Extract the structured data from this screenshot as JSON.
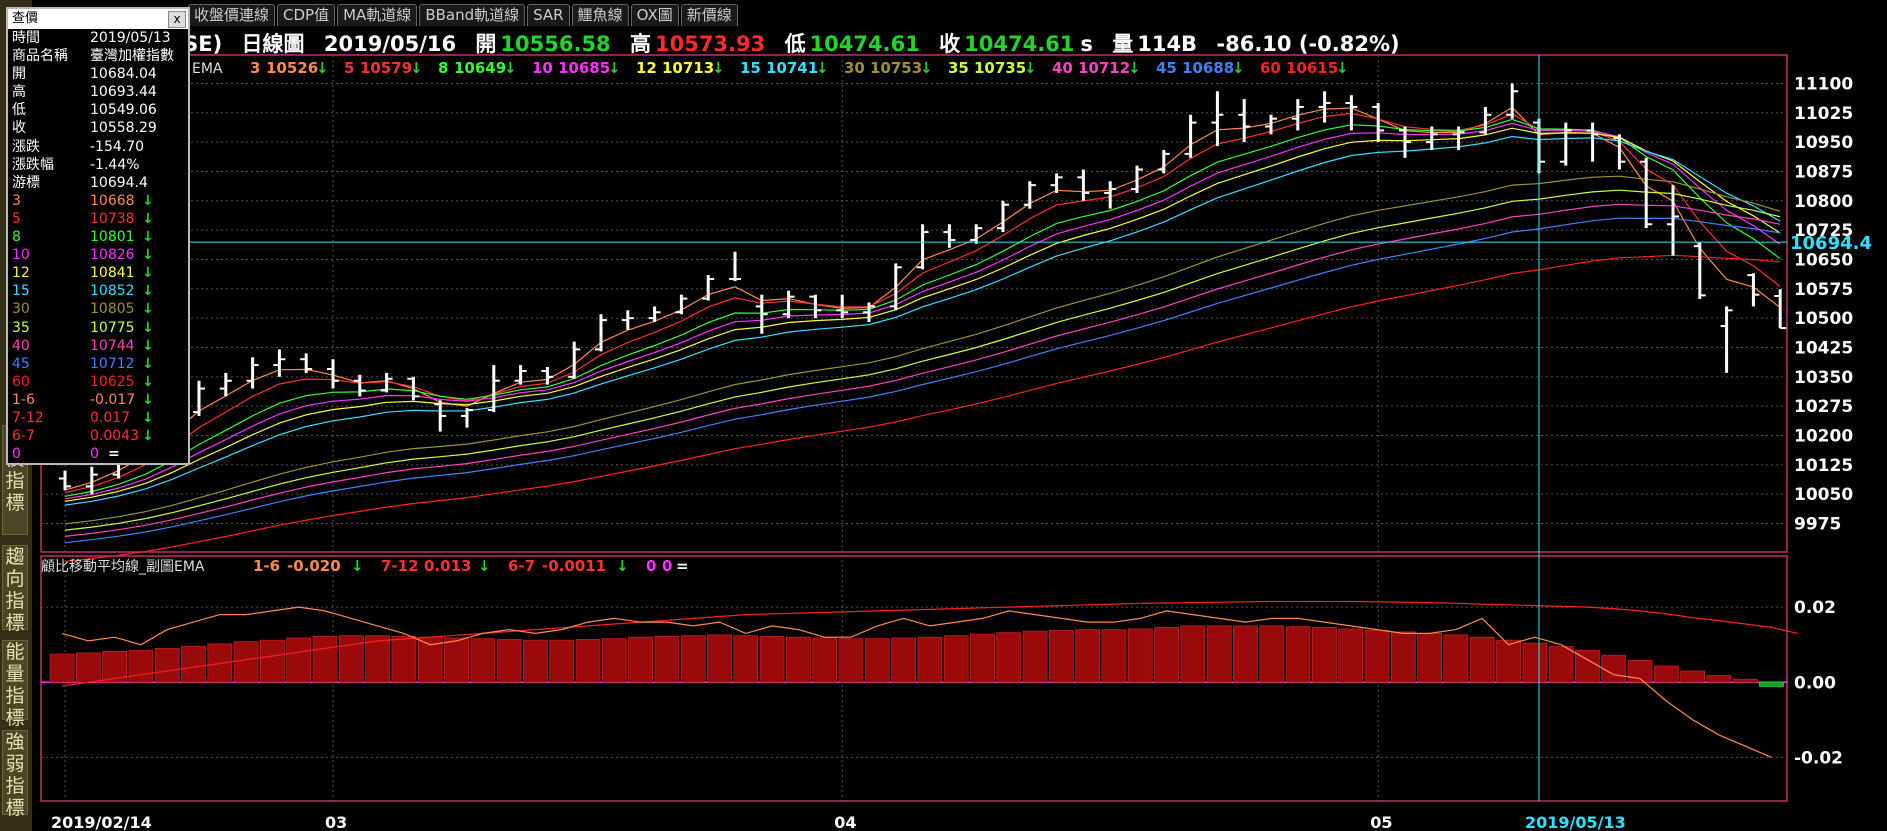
{
  "tabs": [
    "收盤價連線",
    "CDP值",
    "MA軌道線",
    "BBand軌道線",
    "SAR",
    "鱷魚線",
    "OX圖",
    "新價線"
  ],
  "header": {
    "symbol": "WSE)",
    "chart_type": "日線圖",
    "date": "2019/05/16",
    "open_label": "開",
    "open": "10556.58",
    "high_label": "高",
    "high": "10573.93",
    "low_label": "低",
    "low": "10474.61",
    "close_label": "收",
    "close": "10474.61",
    "close_suffix": "s",
    "volume_label": "量",
    "volume": "114B",
    "change": "-86.10 (-0.82%)"
  },
  "ema_legend": {
    "prefix": "EMA",
    "items": [
      {
        "label": "3",
        "value": "10526",
        "color": "#ff8a4a"
      },
      {
        "label": "5",
        "value": "10579",
        "color": "#ff3030"
      },
      {
        "label": "8",
        "value": "10649",
        "color": "#30ff30"
      },
      {
        "label": "10",
        "value": "10685",
        "color": "#ff30ff"
      },
      {
        "label": "12",
        "value": "10713",
        "color": "#ffff30"
      },
      {
        "label": "15",
        "value": "10741",
        "color": "#30e0ff"
      },
      {
        "label": "30",
        "value": "10753",
        "color": "#a09030"
      },
      {
        "label": "35",
        "value": "10735",
        "color": "#d0ff30"
      },
      {
        "label": "40",
        "value": "10712",
        "color": "#ff40c0"
      },
      {
        "label": "45",
        "value": "10688",
        "color": "#4080ff"
      },
      {
        "label": "60",
        "value": "10615",
        "color": "#ff2020"
      }
    ]
  },
  "sub_legend": {
    "title": "顧比移動平均線_副圖EMA",
    "items": [
      {
        "label": "1-6",
        "value": "-0.020",
        "color": "#ff8a4a",
        "arrow": "↓"
      },
      {
        "label": "7-12",
        "value": "0.013",
        "color": "#ff3030",
        "arrow": "↓"
      },
      {
        "label": "6-7",
        "value": "-0.0011",
        "color": "#ff3030",
        "arrow": "↓"
      },
      {
        "label": "0",
        "value": "0",
        "color": "#ff30ff",
        "arrow": "="
      }
    ]
  },
  "crosshair_label": "10694.4",
  "sidebar": [
    "能價指標",
    "趨向指標",
    "能量指標",
    "強弱指標"
  ],
  "query": {
    "title": "查價",
    "close_icon": "x",
    "rows": [
      {
        "label": "時間",
        "value": "2019/05/13",
        "color": "#ffffff",
        "arrow": ""
      },
      {
        "label": "商品名稱",
        "value": "臺灣加權指數",
        "color": "#ffffff",
        "arrow": ""
      },
      {
        "label": "開",
        "value": "10684.04",
        "color": "#ffffff",
        "arrow": ""
      },
      {
        "label": "高",
        "value": "10693.44",
        "color": "#ffffff",
        "arrow": ""
      },
      {
        "label": "低",
        "value": "10549.06",
        "color": "#ffffff",
        "arrow": ""
      },
      {
        "label": "收",
        "value": "10558.29",
        "color": "#ffffff",
        "arrow": ""
      },
      {
        "label": "漲跌",
        "value": "-154.70",
        "color": "#ffffff",
        "arrow": ""
      },
      {
        "label": "漲跌幅",
        "value": "-1.44%",
        "color": "#ffffff",
        "arrow": ""
      },
      {
        "label": "游標",
        "value": "10694.4",
        "color": "#ffffff",
        "arrow": ""
      },
      {
        "label": "3",
        "value": "10668",
        "color": "#ff8a4a",
        "arrow": "↓"
      },
      {
        "label": "5",
        "value": "10738",
        "color": "#ff3030",
        "arrow": "↓"
      },
      {
        "label": "8",
        "value": "10801",
        "color": "#30ff30",
        "arrow": "↓"
      },
      {
        "label": "10",
        "value": "10826",
        "color": "#ff30ff",
        "arrow": "↓"
      },
      {
        "label": "12",
        "value": "10841",
        "color": "#ffff30",
        "arrow": "↓"
      },
      {
        "label": "15",
        "value": "10852",
        "color": "#30e0ff",
        "arrow": "↓"
      },
      {
        "label": "30",
        "value": "10805",
        "color": "#a09030",
        "arrow": "↓"
      },
      {
        "label": "35",
        "value": "10775",
        "color": "#d0ff30",
        "arrow": "↓"
      },
      {
        "label": "40",
        "value": "10744",
        "color": "#ff40c0",
        "arrow": "↓"
      },
      {
        "label": "45",
        "value": "10712",
        "color": "#4080ff",
        "arrow": "↓"
      },
      {
        "label": "60",
        "value": "10625",
        "color": "#ff2020",
        "arrow": "↓"
      },
      {
        "label": "1-6",
        "value": "-0.017",
        "color": "#ff8a4a",
        "arrow": "↓"
      },
      {
        "label": "7-12",
        "value": "0.017",
        "color": "#ff3030",
        "arrow": "↓"
      },
      {
        "label": "6-7",
        "value": "0.0043",
        "color": "#ff3030",
        "arrow": "↓"
      },
      {
        "label": "0",
        "value": "0",
        "color": "#ff30ff",
        "arrow": "="
      }
    ]
  },
  "chart_data": [
    {
      "type": "ohlc",
      "ylim": [
        9920,
        11160
      ],
      "yticks": [
        11100,
        11025,
        10950,
        10875,
        10800,
        10725,
        10650,
        10575,
        10500,
        10425,
        10350,
        10275,
        10200,
        10125,
        10050,
        9975
      ],
      "xticks": [
        {
          "label": "2019/02/14",
          "index": 0,
          "highlight": false
        },
        {
          "label": "03",
          "index": 10,
          "highlight": false
        },
        {
          "label": "04",
          "index": 29,
          "highlight": false
        },
        {
          "label": "05",
          "index": 49,
          "highlight": false
        },
        {
          "label": "2019/05/13",
          "index": 55,
          "highlight": true
        }
      ],
      "crosshair": {
        "index": 55,
        "value": 10694.4
      },
      "bars": [
        {
          "o": 10090,
          "h": 10110,
          "l": 10060,
          "c": 10070
        },
        {
          "o": 10070,
          "h": 10120,
          "l": 10050,
          "c": 10100
        },
        {
          "o": 10100,
          "h": 10160,
          "l": 10090,
          "c": 10140
        },
        {
          "o": 10140,
          "h": 10200,
          "l": 10130,
          "c": 10190
        },
        {
          "o": 10190,
          "h": 10280,
          "l": 10180,
          "c": 10260
        },
        {
          "o": 10260,
          "h": 10340,
          "l": 10250,
          "c": 10320
        },
        {
          "o": 10320,
          "h": 10360,
          "l": 10300,
          "c": 10340
        },
        {
          "o": 10340,
          "h": 10400,
          "l": 10320,
          "c": 10380
        },
        {
          "o": 10380,
          "h": 10420,
          "l": 10350,
          "c": 10395
        },
        {
          "o": 10395,
          "h": 10410,
          "l": 10360,
          "c": 10370
        },
        {
          "o": 10370,
          "h": 10395,
          "l": 10320,
          "c": 10340
        },
        {
          "o": 10340,
          "h": 10355,
          "l": 10300,
          "c": 10315
        },
        {
          "o": 10315,
          "h": 10360,
          "l": 10310,
          "c": 10345
        },
        {
          "o": 10345,
          "h": 10350,
          "l": 10290,
          "c": 10300
        },
        {
          "o": 10280,
          "h": 10290,
          "l": 10210,
          "c": 10250
        },
        {
          "o": 10250,
          "h": 10270,
          "l": 10220,
          "c": 10265
        },
        {
          "o": 10265,
          "h": 10380,
          "l": 10260,
          "c": 10340
        },
        {
          "o": 10340,
          "h": 10380,
          "l": 10330,
          "c": 10365
        },
        {
          "o": 10365,
          "h": 10375,
          "l": 10330,
          "c": 10350
        },
        {
          "o": 10350,
          "h": 10440,
          "l": 10345,
          "c": 10420
        },
        {
          "o": 10420,
          "h": 10510,
          "l": 10415,
          "c": 10495
        },
        {
          "o": 10495,
          "h": 10520,
          "l": 10470,
          "c": 10500
        },
        {
          "o": 10500,
          "h": 10530,
          "l": 10490,
          "c": 10515
        },
        {
          "o": 10515,
          "h": 10560,
          "l": 10510,
          "c": 10550
        },
        {
          "o": 10550,
          "h": 10610,
          "l": 10545,
          "c": 10600
        },
        {
          "o": 10600,
          "h": 10670,
          "l": 10595,
          "c": 10600
        },
        {
          "o": 10530,
          "h": 10560,
          "l": 10460,
          "c": 10510
        },
        {
          "o": 10510,
          "h": 10570,
          "l": 10500,
          "c": 10555
        },
        {
          "o": 10555,
          "h": 10560,
          "l": 10500,
          "c": 10520
        },
        {
          "o": 10520,
          "h": 10560,
          "l": 10500,
          "c": 10515
        },
        {
          "o": 10515,
          "h": 10540,
          "l": 10490,
          "c": 10530
        },
        {
          "o": 10530,
          "h": 10640,
          "l": 10520,
          "c": 10630
        },
        {
          "o": 10630,
          "h": 10740,
          "l": 10625,
          "c": 10720
        },
        {
          "o": 10720,
          "h": 10740,
          "l": 10680,
          "c": 10700
        },
        {
          "o": 10700,
          "h": 10740,
          "l": 10690,
          "c": 10730
        },
        {
          "o": 10730,
          "h": 10800,
          "l": 10720,
          "c": 10790
        },
        {
          "o": 10790,
          "h": 10850,
          "l": 10780,
          "c": 10840
        },
        {
          "o": 10840,
          "h": 10870,
          "l": 10820,
          "c": 10860
        },
        {
          "o": 10860,
          "h": 10880,
          "l": 10800,
          "c": 10820
        },
        {
          "o": 10820,
          "h": 10850,
          "l": 10780,
          "c": 10830
        },
        {
          "o": 10830,
          "h": 10890,
          "l": 10820,
          "c": 10880
        },
        {
          "o": 10880,
          "h": 10930,
          "l": 10870,
          "c": 10920
        },
        {
          "o": 10920,
          "h": 11020,
          "l": 10910,
          "c": 11000
        },
        {
          "o": 11000,
          "h": 11080,
          "l": 10940,
          "c": 11020
        },
        {
          "o": 11020,
          "h": 11060,
          "l": 10950,
          "c": 10990
        },
        {
          "o": 10990,
          "h": 11020,
          "l": 10970,
          "c": 11010
        },
        {
          "o": 11010,
          "h": 11060,
          "l": 10980,
          "c": 11040
        },
        {
          "o": 11040,
          "h": 11080,
          "l": 11000,
          "c": 11050
        },
        {
          "o": 11050,
          "h": 11070,
          "l": 10980,
          "c": 11040
        },
        {
          "o": 11040,
          "h": 11050,
          "l": 10950,
          "c": 10980
        },
        {
          "o": 10980,
          "h": 10990,
          "l": 10910,
          "c": 10950
        },
        {
          "o": 10950,
          "h": 10990,
          "l": 10930,
          "c": 10970
        },
        {
          "o": 10970,
          "h": 10990,
          "l": 10930,
          "c": 10975
        },
        {
          "o": 10975,
          "h": 11040,
          "l": 10970,
          "c": 11020
        },
        {
          "o": 11020,
          "h": 11100,
          "l": 11010,
          "c": 11080
        },
        {
          "o": 11000,
          "h": 11010,
          "l": 10870,
          "c": 10900
        },
        {
          "o": 10900,
          "h": 11000,
          "l": 10890,
          "c": 10980
        },
        {
          "o": 10980,
          "h": 11000,
          "l": 10900,
          "c": 10970
        },
        {
          "o": 10960,
          "h": 10970,
          "l": 10880,
          "c": 10900
        },
        {
          "o": 10900,
          "h": 10910,
          "l": 10730,
          "c": 10740
        },
        {
          "o": 10740,
          "h": 10840,
          "l": 10660,
          "c": 10760
        },
        {
          "o": 10684.04,
          "h": 10693.44,
          "l": 10549.06,
          "c": 10558.29
        },
        {
          "o": 10480,
          "h": 10530,
          "l": 10360,
          "c": 10520
        },
        {
          "o": 10610,
          "h": 10615,
          "l": 10530,
          "c": 10560
        },
        {
          "o": 10556.58,
          "h": 10573.93,
          "l": 10474.61,
          "c": 10474.61
        }
      ]
    },
    {
      "type": "bar",
      "ylim": [
        -0.03,
        0.032
      ],
      "yticks": [
        0.02,
        0.0,
        -0.02
      ],
      "ytick_labels": [
        "0.02",
        "0.00",
        "-0.02"
      ],
      "series": [
        {
          "name": "6-7",
          "values": [
            0.0075,
            0.0078,
            0.0082,
            0.0085,
            0.009,
            0.0096,
            0.0102,
            0.0108,
            0.0112,
            0.0118,
            0.0122,
            0.0124,
            0.0124,
            0.0122,
            0.012,
            0.0118,
            0.0116,
            0.0114,
            0.0112,
            0.0112,
            0.0114,
            0.0116,
            0.012,
            0.0122,
            0.0124,
            0.0126,
            0.0124,
            0.0122,
            0.012,
            0.0118,
            0.0116,
            0.0116,
            0.0118,
            0.012,
            0.0124,
            0.0128,
            0.0132,
            0.0136,
            0.0138,
            0.014,
            0.014,
            0.0142,
            0.0146,
            0.015,
            0.015,
            0.015,
            0.015,
            0.0148,
            0.0146,
            0.0142,
            0.0138,
            0.0134,
            0.013,
            0.0126,
            0.012,
            0.0112,
            0.0104,
            0.0095,
            0.0085,
            0.0072,
            0.0058,
            0.0043,
            0.003,
            0.0018,
            0.0008,
            -0.0011
          ]
        },
        {
          "name": "7-12",
          "values": [
            -0.001,
            0.0,
            0.001,
            0.002,
            0.003,
            0.004,
            0.005,
            0.006,
            0.007,
            0.008,
            0.009,
            0.01,
            0.011,
            0.0115,
            0.012,
            0.0125,
            0.013,
            0.0135,
            0.014,
            0.0145,
            0.015,
            0.0155,
            0.016,
            0.0165,
            0.017,
            0.0175,
            0.018,
            0.0182,
            0.0184,
            0.0186,
            0.0188,
            0.019,
            0.0192,
            0.0194,
            0.0196,
            0.0198,
            0.02,
            0.0202,
            0.0204,
            0.0206,
            0.0208,
            0.021,
            0.0211,
            0.0212,
            0.0213,
            0.0214,
            0.0215,
            0.0215,
            0.0215,
            0.0215,
            0.0214,
            0.0213,
            0.0212,
            0.021,
            0.0208,
            0.0206,
            0.0204,
            0.0202,
            0.02,
            0.0196,
            0.019,
            0.0182,
            0.0172,
            0.0164,
            0.0155,
            0.0146,
            0.013
          ]
        },
        {
          "name": "1-6",
          "values": [
            0.013,
            0.011,
            0.012,
            0.01,
            0.014,
            0.016,
            0.018,
            0.018,
            0.019,
            0.02,
            0.019,
            0.017,
            0.015,
            0.013,
            0.01,
            0.011,
            0.013,
            0.014,
            0.013,
            0.014,
            0.016,
            0.017,
            0.016,
            0.016,
            0.015,
            0.016,
            0.013,
            0.015,
            0.014,
            0.012,
            0.012,
            0.015,
            0.017,
            0.015,
            0.016,
            0.017,
            0.019,
            0.018,
            0.017,
            0.016,
            0.016,
            0.017,
            0.019,
            0.018,
            0.017,
            0.016,
            0.017,
            0.017,
            0.016,
            0.015,
            0.014,
            0.013,
            0.013,
            0.014,
            0.017,
            0.01,
            0.012,
            0.01,
            0.006,
            0.002,
            0.001,
            -0.005,
            -0.01,
            -0.014,
            -0.017,
            -0.02
          ]
        }
      ]
    }
  ]
}
